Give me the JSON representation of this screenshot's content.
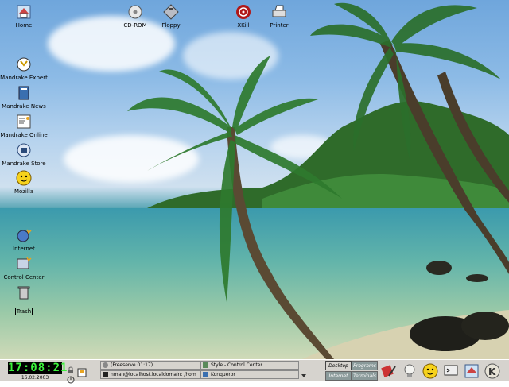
{
  "desktop": {
    "icons": {
      "home": "Home",
      "cdrom": "CD-ROM",
      "floppy": "Floppy",
      "xkill": "XKill",
      "printer": "Printer",
      "mandrake_expert": "Mandrake Expert",
      "mandrake_news": "Mandrake News",
      "mandrake_online": "Mandrake Online",
      "mandrake_store": "Mandrake Store",
      "mozilla": "Mozilla",
      "internet": "Internet",
      "control_center": "Control Center",
      "trash": "Trash"
    }
  },
  "panel": {
    "clock": "17:08:21",
    "date": "16.02.2003",
    "tasks": [
      "(Freeserve 01:17)",
      "nman@localhost.localdomain: /hom",
      "Style - Control Center",
      "Konqueror"
    ],
    "pager": {
      "desktop": "Desktop",
      "programs": "Programs",
      "internet": "Internet",
      "terminals": "Terminals"
    }
  }
}
